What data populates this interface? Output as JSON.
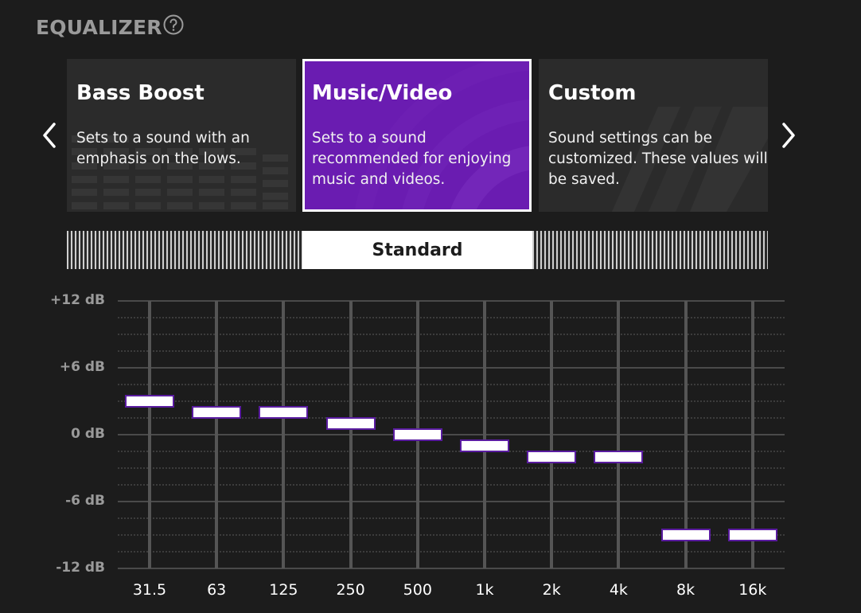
{
  "header": {
    "title": "EQUALIZER",
    "help_icon": "question-circle-icon"
  },
  "presets": [
    {
      "title": "Bass Boost",
      "description": "Sets to a sound with an\nemphasis on the lows.",
      "selected": false
    },
    {
      "title": "Music/Video",
      "description": "Sets to a sound\nrecommended for enjoying\nmusic and videos.",
      "selected": true
    },
    {
      "title": "Custom",
      "description": "Sound settings can be\ncustomized. These values will\nbe saved.",
      "selected": false
    }
  ],
  "nav": {
    "prev_icon": "chevron-left-icon",
    "next_icon": "chevron-right-icon"
  },
  "preset_selector": {
    "label": "Standard"
  },
  "eq": {
    "y_labels": [
      "+12 dB",
      "+6 dB",
      "0 dB",
      "-6 dB",
      "-12 dB"
    ],
    "range_db": [
      -12,
      12
    ],
    "bands": [
      {
        "label": "31.5",
        "db": 3
      },
      {
        "label": "63",
        "db": 2
      },
      {
        "label": "125",
        "db": 2
      },
      {
        "label": "250",
        "db": 1
      },
      {
        "label": "500",
        "db": 0
      },
      {
        "label": "1k",
        "db": -1
      },
      {
        "label": "2k",
        "db": -2
      },
      {
        "label": "4k",
        "db": -2
      },
      {
        "label": "8k",
        "db": -9
      },
      {
        "label": "16k",
        "db": -9
      }
    ]
  },
  "colors": {
    "accent": "#6a1cb1",
    "background": "#1c1c1c",
    "card": "#2b2b2b"
  }
}
